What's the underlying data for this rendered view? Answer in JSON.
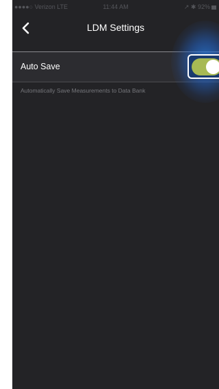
{
  "status_bar": {
    "signal_label": "●●●●○ Verizon  LTE",
    "time": "11:44 AM",
    "battery_label": "↗ ✱ 92%"
  },
  "nav": {
    "back_icon": "chevron-left-icon",
    "title": "LDM Settings"
  },
  "settings": {
    "auto_save": {
      "label": "Auto Save",
      "enabled": true,
      "description": "Automatically Save Measurements to Data Bank"
    }
  },
  "colors": {
    "background": "#232326",
    "toggle_on": "#a7b954",
    "focus_glow": "#2878dc"
  }
}
